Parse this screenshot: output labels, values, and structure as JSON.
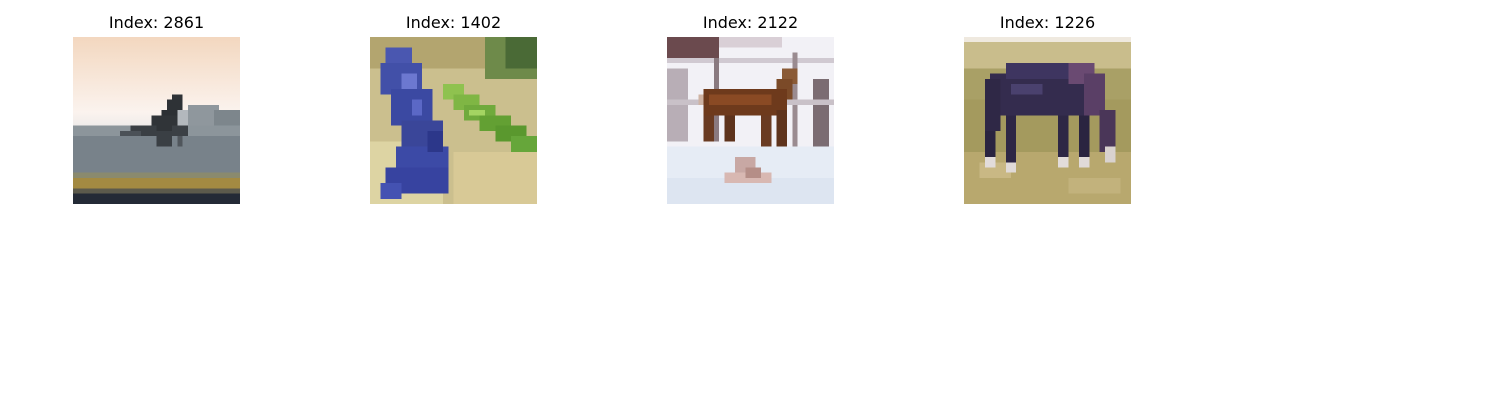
{
  "panels": [
    {
      "title": "Index: 2861",
      "subject": "horse-silhouette"
    },
    {
      "title": "Index: 1402",
      "subject": "blue-frog"
    },
    {
      "title": "Index: 2122",
      "subject": "deer-in-snow"
    },
    {
      "title": "Index: 1226",
      "subject": "grazing-horse"
    }
  ]
}
